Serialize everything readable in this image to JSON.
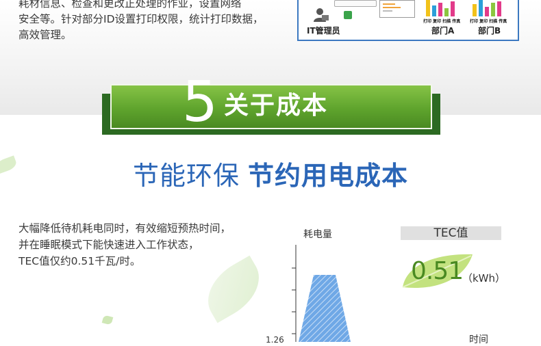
{
  "top": {
    "intro_lines": [
      "耗材信息、检查和更改正处理的作业，设置网络",
      "安全等。针对部分ID设置打印权限，统计打印数据，",
      "高效管理。"
    ],
    "it_admin_label": "IT管理员",
    "bar_caption": "打印 复印 扫描 传真",
    "dept_a": "部门A",
    "dept_b": "部门B"
  },
  "section": {
    "number": "5",
    "title": "关于成本"
  },
  "headline": {
    "part1": "节能环保",
    "part2": "节约用电成本"
  },
  "body": {
    "lines": [
      "大幅降低待机耗电同时，有效缩短预热时间，",
      "并在睡眠模式下能快速进入工作状态，",
      "TEC值仅约0.51千瓦/时。"
    ]
  },
  "chart": {
    "y_axis_label": "耗电量",
    "x_axis_label": "时间",
    "tick_value": "1.26"
  },
  "tec": {
    "label": "TEC值",
    "value": "0.51",
    "unit": "（kWh）"
  },
  "colors": {
    "accent_blue": "#2b66b7",
    "banner_green": "#5fa42d",
    "leaf_green": "#c3e27f"
  }
}
